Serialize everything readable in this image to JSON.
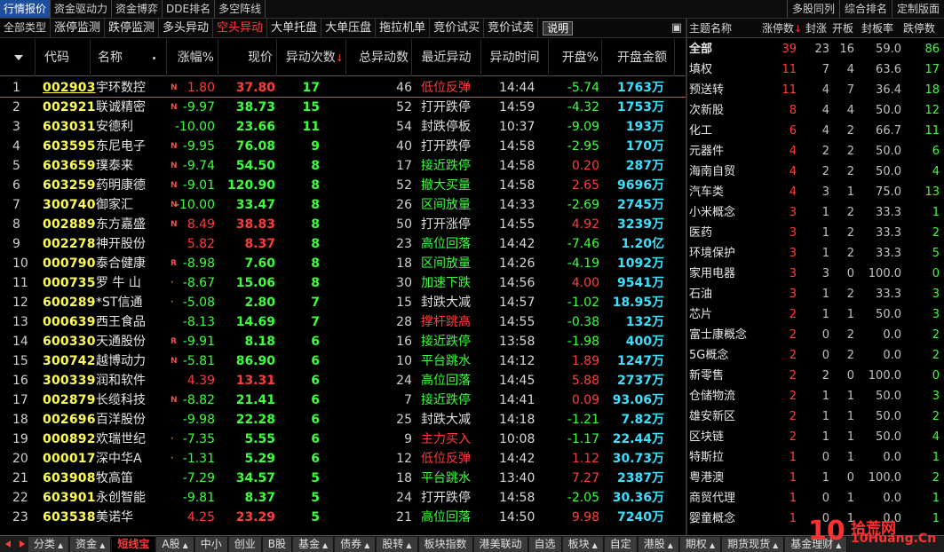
{
  "top_tabs": [
    "行情报价",
    "资金驱动力",
    "资金博弈",
    "DDE排名",
    "多空阵线"
  ],
  "top_right": [
    "多股同列",
    "综合排名",
    "定制版面"
  ],
  "sub_tabs": [
    "全部类型",
    "涨停监测",
    "跌停监测",
    "多头异动",
    "空头异动",
    "大单托盘",
    "大单压盘",
    "拖拉机单",
    "竞价试买",
    "竞价试卖"
  ],
  "explain_label": "说明",
  "end_mark": "▣",
  "columns": {
    "code": "代码",
    "name": "名称",
    "pct": "涨幅%",
    "price": "现价",
    "cnt": "异动次数",
    "cnt_sort": "↓",
    "total": "总异动数",
    "recent": "最近异动",
    "time": "异动时间",
    "open": "开盘%",
    "amt": "开盘金额"
  },
  "rows": [
    {
      "seq": "1",
      "code": "002903",
      "name": "宇环数控",
      "flag": "N",
      "pct": "1.80",
      "price": "37.80",
      "cnt": "17",
      "total": "46",
      "recent": "低位反弹",
      "rc": "red",
      "time": "14:44",
      "open": "-5.74",
      "amt": "1763万"
    },
    {
      "seq": "2",
      "code": "002921",
      "name": "联诚精密",
      "flag": "N",
      "pct": "-9.97",
      "price": "38.73",
      "cnt": "15",
      "total": "52",
      "recent": "打开跌停",
      "rc": "white",
      "time": "14:59",
      "open": "-4.32",
      "amt": "1753万"
    },
    {
      "seq": "3",
      "code": "603031",
      "name": "安德利",
      "flag": "",
      "pct": "-10.00",
      "price": "23.66",
      "cnt": "11",
      "total": "54",
      "recent": "封跌停板",
      "rc": "white",
      "time": "10:37",
      "open": "-9.09",
      "amt": "193万"
    },
    {
      "seq": "4",
      "code": "603595",
      "name": "东尼电子",
      "flag": "N",
      "pct": "-9.95",
      "price": "76.08",
      "cnt": "9",
      "total": "40",
      "recent": "打开跌停",
      "rc": "white",
      "time": "14:58",
      "open": "-2.95",
      "amt": "170万"
    },
    {
      "seq": "5",
      "code": "603659",
      "name": "璞泰来",
      "flag": "N",
      "pct": "-9.74",
      "price": "54.50",
      "cnt": "8",
      "total": "17",
      "recent": "接近跌停",
      "rc": "green",
      "time": "14:58",
      "open": "0.20",
      "amt": "287万"
    },
    {
      "seq": "6",
      "code": "603259",
      "name": "药明康德",
      "flag": "N",
      "pct": "-9.01",
      "price": "120.90",
      "cnt": "8",
      "total": "52",
      "recent": "撤大买量",
      "rc": "green",
      "time": "14:58",
      "open": "2.65",
      "amt": "9696万"
    },
    {
      "seq": "7",
      "code": "300740",
      "name": "御家汇",
      "flag": "N",
      "pct": "-10.00",
      "price": "33.47",
      "cnt": "8",
      "total": "26",
      "recent": "区间放量",
      "rc": "green",
      "time": "14:33",
      "open": "-2.69",
      "amt": "2745万"
    },
    {
      "seq": "8",
      "code": "002889",
      "name": "东方嘉盛",
      "flag": "N",
      "pct": "8.49",
      "price": "38.83",
      "cnt": "8",
      "total": "50",
      "recent": "打开涨停",
      "rc": "white",
      "time": "14:55",
      "open": "4.92",
      "amt": "3239万"
    },
    {
      "seq": "9",
      "code": "002278",
      "name": "神开股份",
      "flag": "",
      "pct": "5.82",
      "price": "8.37",
      "cnt": "8",
      "total": "23",
      "recent": "高位回落",
      "rc": "green",
      "time": "14:42",
      "open": "-7.46",
      "amt": "1.20亿"
    },
    {
      "seq": "10",
      "code": "000790",
      "name": "泰合健康",
      "flag": "R",
      "pct": "-8.98",
      "price": "7.60",
      "cnt": "8",
      "total": "18",
      "recent": "区间放量",
      "rc": "green",
      "time": "14:26",
      "open": "-4.19",
      "amt": "1092万"
    },
    {
      "seq": "11",
      "code": "000735",
      "name": "罗 牛 山",
      "flag": "·",
      "pct": "-8.67",
      "price": "15.06",
      "cnt": "8",
      "total": "30",
      "recent": "加速下跌",
      "rc": "green",
      "time": "14:56",
      "open": "4.00",
      "amt": "9541万"
    },
    {
      "seq": "12",
      "code": "600289",
      "name": "*ST信通",
      "flag": "·",
      "pct": "-5.08",
      "price": "2.80",
      "cnt": "7",
      "total": "15",
      "recent": "封跌大减",
      "rc": "white",
      "time": "14:57",
      "open": "-1.02",
      "amt": "18.95万"
    },
    {
      "seq": "13",
      "code": "000639",
      "name": "西王食品",
      "flag": "",
      "pct": "-8.13",
      "price": "14.69",
      "cnt": "7",
      "total": "28",
      "recent": "撑杆跳高",
      "rc": "red",
      "time": "14:55",
      "open": "-0.38",
      "amt": "132万"
    },
    {
      "seq": "14",
      "code": "600330",
      "name": "天通股份",
      "flag": "R",
      "pct": "-9.91",
      "price": "8.18",
      "cnt": "6",
      "total": "16",
      "recent": "接近跌停",
      "rc": "green",
      "time": "13:58",
      "open": "-1.98",
      "amt": "400万"
    },
    {
      "seq": "15",
      "code": "300742",
      "name": "越博动力",
      "flag": "N",
      "pct": "-5.81",
      "price": "86.90",
      "cnt": "6",
      "total": "10",
      "recent": "平台跳水",
      "rc": "green",
      "time": "14:12",
      "open": "1.89",
      "amt": "1247万"
    },
    {
      "seq": "16",
      "code": "300339",
      "name": "润和软件",
      "flag": "",
      "pct": "4.39",
      "price": "13.31",
      "cnt": "6",
      "total": "24",
      "recent": "高位回落",
      "rc": "green",
      "time": "14:45",
      "open": "5.88",
      "amt": "2737万"
    },
    {
      "seq": "17",
      "code": "002879",
      "name": "长缆科技",
      "flag": "N",
      "pct": "-8.82",
      "price": "21.41",
      "cnt": "6",
      "total": "7",
      "recent": "接近跌停",
      "rc": "green",
      "time": "14:41",
      "open": "0.09",
      "amt": "93.06万"
    },
    {
      "seq": "18",
      "code": "002696",
      "name": "百洋股份",
      "flag": "",
      "pct": "-9.98",
      "price": "22.28",
      "cnt": "6",
      "total": "25",
      "recent": "封跌大减",
      "rc": "white",
      "time": "14:18",
      "open": "-1.21",
      "amt": "7.82万"
    },
    {
      "seq": "19",
      "code": "000892",
      "name": "欢瑞世纪",
      "flag": "·",
      "pct": "-7.35",
      "price": "5.55",
      "cnt": "6",
      "total": "9",
      "recent": "主力买入",
      "rc": "red",
      "time": "10:08",
      "open": "-1.17",
      "amt": "22.44万"
    },
    {
      "seq": "20",
      "code": "000017",
      "name": "深中华A",
      "flag": "·",
      "pct": "-1.31",
      "price": "5.29",
      "cnt": "6",
      "total": "12",
      "recent": "低位反弹",
      "rc": "red",
      "time": "14:42",
      "open": "1.12",
      "amt": "30.73万"
    },
    {
      "seq": "21",
      "code": "603908",
      "name": "牧高笛",
      "flag": "",
      "pct": "-7.29",
      "price": "34.57",
      "cnt": "5",
      "total": "18",
      "recent": "平台跳水",
      "rc": "green",
      "time": "13:40",
      "open": "7.27",
      "amt": "2387万"
    },
    {
      "seq": "22",
      "code": "603901",
      "name": "永创智能",
      "flag": "",
      "pct": "-9.81",
      "price": "8.37",
      "cnt": "5",
      "total": "24",
      "recent": "打开跌停",
      "rc": "white",
      "time": "14:58",
      "open": "-2.05",
      "amt": "30.36万"
    },
    {
      "seq": "23",
      "code": "603538",
      "name": "美诺华",
      "flag": "",
      "pct": "4.25",
      "price": "23.29",
      "cnt": "5",
      "total": "21",
      "recent": "高位回落",
      "rc": "green",
      "time": "14:50",
      "open": "9.98",
      "amt": "7240万"
    }
  ],
  "right_columns": [
    "主题名称",
    "涨停数",
    "封涨",
    "开板",
    "封板率",
    "跌停数"
  ],
  "right_sort_mark": "↓",
  "themes": [
    {
      "name": "全部",
      "a": "39",
      "b": "23",
      "c": "16",
      "d": "59.0",
      "e": "86"
    },
    {
      "name": "填权",
      "a": "11",
      "b": "7",
      "c": "4",
      "d": "63.6",
      "e": "17"
    },
    {
      "name": "预送转",
      "a": "11",
      "b": "4",
      "c": "7",
      "d": "36.4",
      "e": "18"
    },
    {
      "name": "次新股",
      "a": "8",
      "b": "4",
      "c": "4",
      "d": "50.0",
      "e": "12"
    },
    {
      "name": "化工",
      "a": "6",
      "b": "4",
      "c": "2",
      "d": "66.7",
      "e": "11"
    },
    {
      "name": "元器件",
      "a": "4",
      "b": "2",
      "c": "2",
      "d": "50.0",
      "e": "6"
    },
    {
      "name": "海南自贸",
      "a": "4",
      "b": "2",
      "c": "2",
      "d": "50.0",
      "e": "4"
    },
    {
      "name": "汽车类",
      "a": "4",
      "b": "3",
      "c": "1",
      "d": "75.0",
      "e": "13"
    },
    {
      "name": "小米概念",
      "a": "3",
      "b": "1",
      "c": "2",
      "d": "33.3",
      "e": "1"
    },
    {
      "name": "医药",
      "a": "3",
      "b": "1",
      "c": "2",
      "d": "33.3",
      "e": "2"
    },
    {
      "name": "环境保护",
      "a": "3",
      "b": "1",
      "c": "2",
      "d": "33.3",
      "e": "5"
    },
    {
      "name": "家用电器",
      "a": "3",
      "b": "3",
      "c": "0",
      "d": "100.0",
      "e": "0"
    },
    {
      "name": "石油",
      "a": "3",
      "b": "1",
      "c": "2",
      "d": "33.3",
      "e": "3"
    },
    {
      "name": "芯片",
      "a": "2",
      "b": "1",
      "c": "1",
      "d": "50.0",
      "e": "3"
    },
    {
      "name": "富士康概念",
      "a": "2",
      "b": "0",
      "c": "2",
      "d": "0.0",
      "e": "2"
    },
    {
      "name": "5G概念",
      "a": "2",
      "b": "0",
      "c": "2",
      "d": "0.0",
      "e": "2"
    },
    {
      "name": "新零售",
      "a": "2",
      "b": "2",
      "c": "0",
      "d": "100.0",
      "e": "0"
    },
    {
      "name": "仓储物流",
      "a": "2",
      "b": "1",
      "c": "1",
      "d": "50.0",
      "e": "3"
    },
    {
      "name": "雄安新区",
      "a": "2",
      "b": "1",
      "c": "1",
      "d": "50.0",
      "e": "2"
    },
    {
      "name": "区块链",
      "a": "2",
      "b": "1",
      "c": "1",
      "d": "50.0",
      "e": "4"
    },
    {
      "name": "特斯拉",
      "a": "1",
      "b": "0",
      "c": "1",
      "d": "0.0",
      "e": "1"
    },
    {
      "name": "粤港澳",
      "a": "1",
      "b": "1",
      "c": "0",
      "d": "100.0",
      "e": "2"
    },
    {
      "name": "商贸代理",
      "a": "1",
      "b": "0",
      "c": "1",
      "d": "0.0",
      "e": "1"
    },
    {
      "name": "婴童概念",
      "a": "1",
      "b": "0",
      "c": "1",
      "d": "0.0",
      "e": "1"
    }
  ],
  "bottom_tabs": [
    {
      "label": "分类",
      "tri": true
    },
    {
      "label": "资金",
      "tri": true
    },
    {
      "label": "短线宝",
      "active": true
    },
    {
      "label": "A股",
      "tri": true
    },
    {
      "label": "中小",
      "tri": false
    },
    {
      "label": "创业",
      "tri": false
    },
    {
      "label": "B股",
      "tri": false
    },
    {
      "label": "基金",
      "tri": true
    },
    {
      "label": "债券",
      "tri": true
    },
    {
      "label": "股转",
      "tri": true
    },
    {
      "label": "板块指数",
      "tri": false
    },
    {
      "label": "港美联动",
      "tri": false
    },
    {
      "label": "自选",
      "tri": false
    },
    {
      "label": "板块",
      "tri": true
    },
    {
      "label": "自定",
      "tri": false
    },
    {
      "label": "港股",
      "tri": true
    },
    {
      "label": "期权",
      "tri": true
    },
    {
      "label": "期货现货",
      "tri": true
    },
    {
      "label": "基金理财",
      "tri": true
    }
  ],
  "logo": {
    "number": "10",
    "cn": "拾荒网",
    "domain": "10Huang.Cn"
  },
  "colors": {
    "up": "#ff3c3c",
    "down": "#3cff3c",
    "code": "#ffff4c",
    "amount": "#3ce0ff",
    "active_tab": "#1f4f9c"
  }
}
